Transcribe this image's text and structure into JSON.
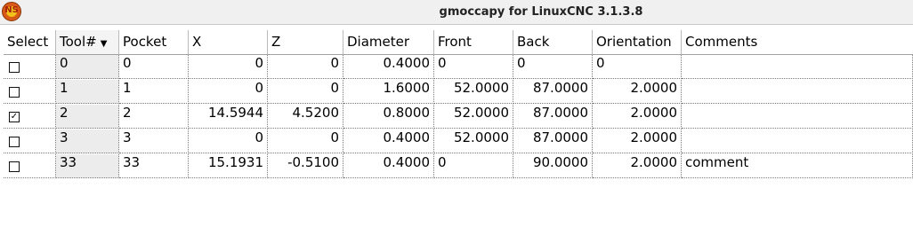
{
  "window": {
    "title": "gmoccapy for LinuxCNC  3.1.3.8",
    "icon_text": "NS"
  },
  "table": {
    "columns": [
      "Select",
      "Tool#",
      "Pocket",
      "X",
      "Z",
      "Diameter",
      "Front",
      "Back",
      "Orientation",
      "Comments"
    ],
    "sorted_column": "Tool#",
    "rows": [
      {
        "select": false,
        "tool": "0",
        "pocket": "0",
        "x": "0",
        "z": "0",
        "diameter": "0.4000",
        "front": "0",
        "back": "0",
        "orientation": "0",
        "comments": ""
      },
      {
        "select": false,
        "tool": "1",
        "pocket": "1",
        "x": "0",
        "z": "0",
        "diameter": "1.6000",
        "front": "52.0000",
        "back": "87.0000",
        "orientation": "2.0000",
        "comments": ""
      },
      {
        "select": true,
        "tool": "2",
        "pocket": "2",
        "x": "14.5944",
        "z": "4.5200",
        "diameter": "0.8000",
        "front": "52.0000",
        "back": "87.0000",
        "orientation": "2.0000",
        "comments": ""
      },
      {
        "select": false,
        "tool": "3",
        "pocket": "3",
        "x": "0",
        "z": "0",
        "diameter": "0.4000",
        "front": "52.0000",
        "back": "87.0000",
        "orientation": "2.0000",
        "comments": ""
      },
      {
        "select": false,
        "tool": "33",
        "pocket": "33",
        "x": "15.1931",
        "z": "-0.5100",
        "diameter": "0.4000",
        "front": "0",
        "back": "90.0000",
        "orientation": "2.0000",
        "comments": "comment"
      }
    ]
  },
  "colors": {
    "title_bar": "#f0f0f0",
    "tool_column_bg": "#ececec"
  }
}
